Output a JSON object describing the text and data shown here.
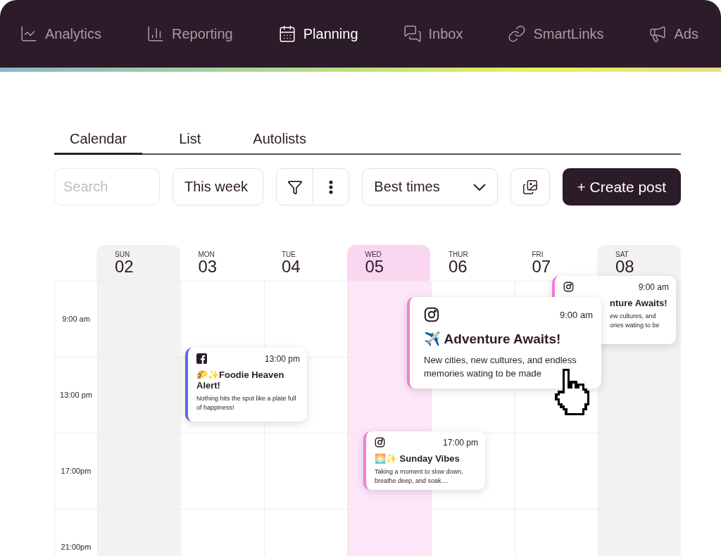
{
  "nav": [
    {
      "label": "Analytics",
      "selected": false
    },
    {
      "label": "Reporting",
      "selected": false
    },
    {
      "label": "Planning",
      "selected": true
    },
    {
      "label": "Inbox",
      "selected": false
    },
    {
      "label": "SmartLinks",
      "selected": false
    },
    {
      "label": "Ads",
      "selected": false
    }
  ],
  "tabs": [
    {
      "label": "Calendar",
      "selected": true
    },
    {
      "label": "List",
      "selected": false
    },
    {
      "label": "Autolists",
      "selected": false
    }
  ],
  "toolbar": {
    "search": {
      "placeholder": "Search"
    },
    "range": "This week",
    "best_times": "Best times",
    "create": "+ Create post"
  },
  "days": [
    {
      "name": "SUN",
      "date": "02",
      "weekend": true,
      "selected": false
    },
    {
      "name": "MON",
      "date": "03",
      "weekend": false,
      "selected": false
    },
    {
      "name": "TUE",
      "date": "04",
      "weekend": false,
      "selected": false
    },
    {
      "name": "WED",
      "date": "05",
      "weekend": false,
      "selected": true
    },
    {
      "name": "THUR",
      "date": "06",
      "weekend": false,
      "selected": false
    },
    {
      "name": "FRI",
      "date": "07",
      "weekend": false,
      "selected": false
    },
    {
      "name": "SAT",
      "date": "08",
      "weekend": true,
      "selected": false
    }
  ],
  "times": [
    "9:00 am",
    "13:00 pm",
    "17:00pm",
    "21:00pm"
  ],
  "posts": [
    {
      "kind": "facebook",
      "color": "#5a6be6",
      "time": "13:00 pm",
      "title": "🌮✨Foodie Heaven Alert!",
      "text": "Nothing hits the spot like a plate full of happiness!"
    },
    {
      "kind": "instagram",
      "color": "#ef7fd8",
      "time": "9:00 am",
      "title": "nture Awaits!",
      "text": "ew cultures, and ories wating to be"
    },
    {
      "kind": "instagram",
      "color": "#ef7fd8",
      "time": "9:00 am",
      "title": "✈️ Adventure Awaits!",
      "text": "New cities, new cultures, and endless memories wating to be made"
    },
    {
      "kind": "instagram",
      "color": "#ef7fd8",
      "time": "17:00 pm",
      "title": "🌅✨ Sunday Vibes",
      "text": "Taking a moment to slow down, breathe deep, and soak...."
    }
  ]
}
